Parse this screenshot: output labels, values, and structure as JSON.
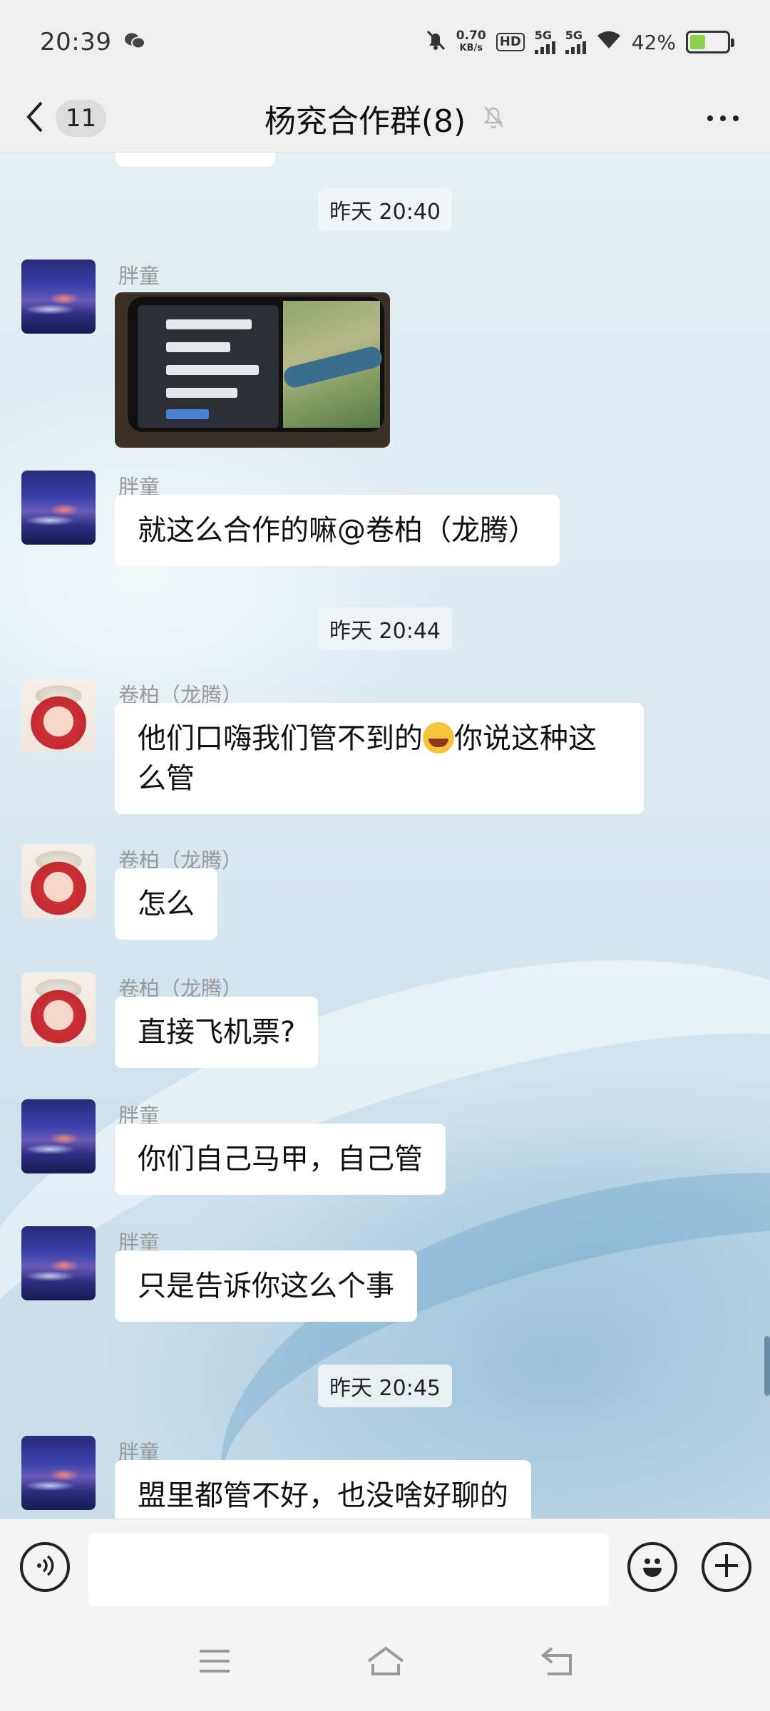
{
  "status_bar": {
    "time": "20:39",
    "net_speed_value": "0.70",
    "net_speed_unit": "KB/s",
    "hd_label": "HD",
    "sim1_label": "5G",
    "sim2_label": "5G",
    "battery_percent": "42%",
    "battery_level": 0.42,
    "battery_color": "#8fd14f"
  },
  "header": {
    "back_badge": "11",
    "title": "杨兖合作群(8)",
    "muted_icon": "bell-off-icon",
    "more_icon": "more-icon"
  },
  "messages": [
    {
      "type": "time",
      "text": "昨天 20:40"
    },
    {
      "type": "image",
      "sender": "胖童",
      "avatar": "night-sky"
    },
    {
      "type": "text",
      "sender": "胖童",
      "avatar": "night-sky",
      "text": "就这么合作的嘛@卷柏（龙腾）"
    },
    {
      "type": "time",
      "text": "昨天 20:44"
    },
    {
      "type": "text",
      "sender": "卷柏（龙腾）",
      "avatar": "anime",
      "text_before": "他们口嗨我们管不到的",
      "emoji": "laughing-crying-emoji",
      "text_after": "你说这种这么管"
    },
    {
      "type": "text",
      "sender": "卷柏（龙腾）",
      "avatar": "anime",
      "text": "怎么"
    },
    {
      "type": "text",
      "sender": "卷柏（龙腾）",
      "avatar": "anime",
      "text": "直接飞机票?"
    },
    {
      "type": "text",
      "sender": "胖童",
      "avatar": "night-sky",
      "text": "你们自己马甲，自己管"
    },
    {
      "type": "text",
      "sender": "胖童",
      "avatar": "night-sky",
      "text": "只是告诉你这么个事"
    },
    {
      "type": "time",
      "text": "昨天 20:45"
    },
    {
      "type": "text",
      "sender": "胖童",
      "avatar": "night-sky",
      "text": "盟里都管不好，也没啥好聊的"
    }
  ],
  "input_bar": {
    "voice_icon": "voice-icon",
    "input_value": "",
    "emoji_icon": "smiley-icon",
    "plus_icon": "plus-icon"
  },
  "nav_bar": {
    "menu_icon": "menu-icon",
    "home_icon": "home-icon",
    "back_icon": "back-icon"
  }
}
